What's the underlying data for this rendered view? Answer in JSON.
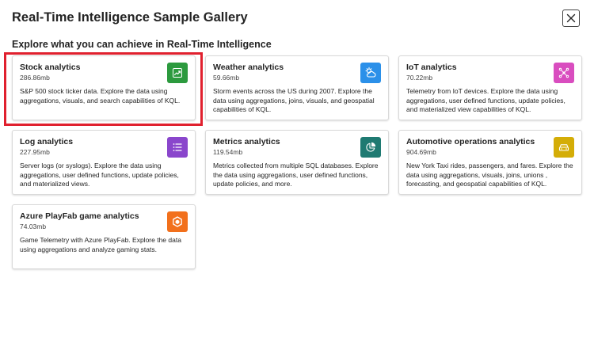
{
  "dialog": {
    "title": "Real-Time Intelligence Sample Gallery",
    "subtitle": "Explore what you can achieve in Real-Time Intelligence"
  },
  "cards": [
    {
      "title": "Stock analytics",
      "size": "286.86mb",
      "description": "S&P 500 stock ticker data. Explore the data using aggregations, visuals, and search capabilities of KQL.",
      "icon": "trend-chart-icon",
      "color": "#2c9a3e",
      "selected": true
    },
    {
      "title": "Weather analytics",
      "size": "59.66mb",
      "description": "Storm events across the US during 2007. Explore the data using aggregations, joins, visuals, and geospatial capabilities of KQL.",
      "icon": "weather-icon",
      "color": "#2b90e9"
    },
    {
      "title": "IoT analytics",
      "size": "70.22mb",
      "description": "Telemetry from IoT devices. Explore the data using aggregations, user defined functions, update policies, and materialized view capabilities of KQL.",
      "icon": "iot-network-icon",
      "color": "#d94dbf"
    },
    {
      "title": "Log analytics",
      "size": "227.95mb",
      "description": "Server logs (or syslogs). Explore the data using aggregations, user defined functions, update policies, and materialized views.",
      "icon": "log-list-icon",
      "color": "#8a46cc"
    },
    {
      "title": "Metrics analytics",
      "size": "119.54mb",
      "description": "Metrics collected from multiple SQL databases. Explore the data using aggregations, user defined functions, update policies, and more.",
      "icon": "pie-chart-icon",
      "color": "#1f7a72"
    },
    {
      "title": "Automotive operations analytics",
      "size": "904.69mb",
      "description": "New York Taxi rides, passengers, and fares. Explore the data using aggregations, visuals, joins, unions , forecasting, and geospatial capabilities of KQL.",
      "icon": "car-icon",
      "color": "#d4ad07"
    },
    {
      "title": "Azure PlayFab game analytics",
      "size": "74.03mb",
      "description": "Game Telemetry with Azure PlayFab. Explore the data using aggregations and analyze gaming stats.",
      "icon": "playfab-icon",
      "color": "#f2701c"
    }
  ]
}
